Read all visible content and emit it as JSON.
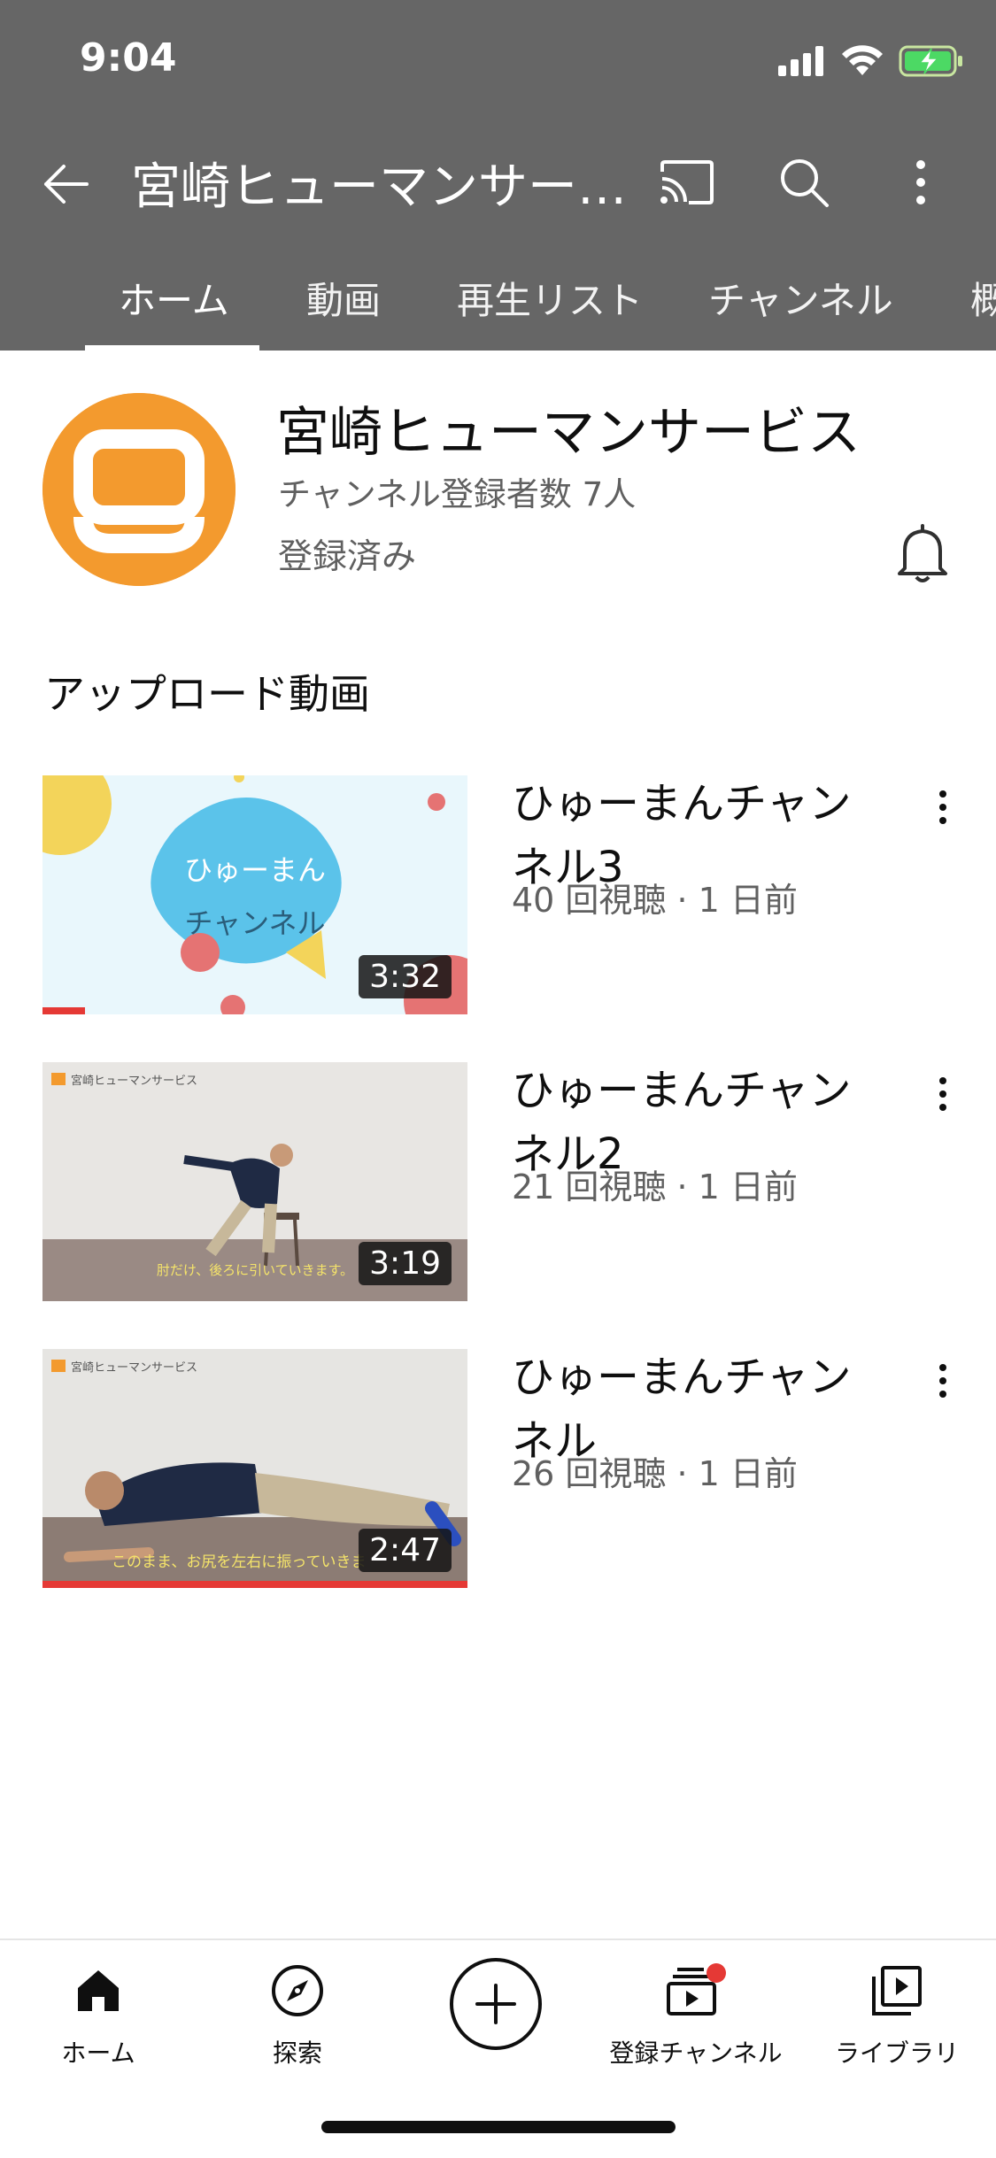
{
  "status": {
    "time": "9:04"
  },
  "header": {
    "channel_title": "宮崎ヒューマンサー…"
  },
  "tabs": [
    "ホーム",
    "動画",
    "再生リスト",
    "チャンネル",
    "概要"
  ],
  "channel": {
    "name": "宮崎ヒューマンサービス",
    "subscribers": "チャンネル登録者数 7人",
    "subscribed_label": "登録済み"
  },
  "section_title": "アップロード動画",
  "videos": [
    {
      "title": "ひゅーまんチャンネル3",
      "meta": "40 回視聴 · 1 日前",
      "duration": "3:32",
      "watched": 0.1,
      "thumb_text_1": "ひゅーまん",
      "thumb_text_2": "チャンネル"
    },
    {
      "title": "ひゅーまんチャンネル2",
      "meta": "21 回視聴 · 1 日前",
      "duration": "3:19",
      "watched": 0,
      "thumb_logo": "宮崎ヒューマンサービス",
      "thumb_caption": "肘だけ、後ろに引いていきます。"
    },
    {
      "title": "ひゅーまんチャンネル",
      "meta": "26 回視聴 · 1 日前",
      "duration": "2:47",
      "watched": 1.0,
      "thumb_logo": "宮崎ヒューマンサービス",
      "thumb_caption": "このまま、お尻を左右に振っていきま"
    }
  ],
  "bottom_nav": {
    "home": "ホーム",
    "explore": "探索",
    "subscriptions": "登録チャンネル",
    "library": "ライブラリ"
  },
  "colors": {
    "header_bg": "#666666",
    "accent_red": "#e53935",
    "avatar_orange": "#f39a2e"
  }
}
